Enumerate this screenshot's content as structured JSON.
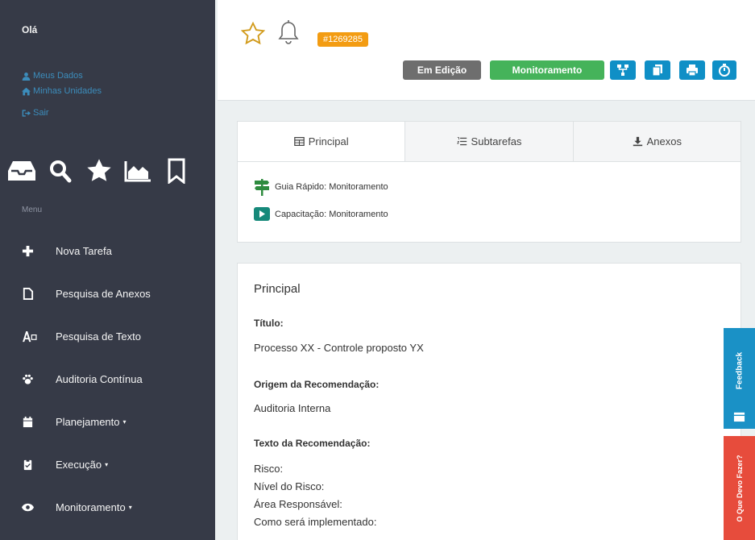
{
  "user": {
    "greeting": "Olá",
    "links": [
      {
        "label": "Meus Dados",
        "icon": "user-icon"
      },
      {
        "label": "Minhas Unidades",
        "icon": "home-icon"
      },
      {
        "label": "Sair",
        "icon": "sign-out-icon"
      }
    ]
  },
  "quick_icons": [
    "inbox-icon",
    "search-icon",
    "star-icon",
    "chart-area-icon",
    "bookmark-icon"
  ],
  "menu": {
    "label": "Menu",
    "items": [
      {
        "label": "Nova Tarefa",
        "icon": "plus-icon"
      },
      {
        "label": "Pesquisa de Anexos",
        "icon": "file-icon"
      },
      {
        "label": "Pesquisa de Texto",
        "icon": "text-search-icon"
      },
      {
        "label": "Auditoria Contínua",
        "icon": "paw-icon"
      },
      {
        "label": "Planejamento",
        "icon": "calendar-icon"
      },
      {
        "label": "Execução",
        "icon": "clipboard-icon"
      },
      {
        "label": "Monitoramento",
        "icon": "eye-icon"
      }
    ]
  },
  "header": {
    "task_id": "#1269285",
    "status_edit": "Em Edição",
    "status_monitor": "Monitoramento"
  },
  "tabs": [
    {
      "label": "Principal",
      "icon": "table-icon"
    },
    {
      "label": "Subtarefas",
      "icon": "list-ol-icon"
    },
    {
      "label": "Anexos",
      "icon": "download-icon"
    }
  ],
  "guides": {
    "quick_guide": "Guia Rápido: Monitoramento",
    "training": "Capacitação: Monitoramento"
  },
  "principal": {
    "title": "Principal",
    "titulo_label": "Título:",
    "titulo_value": "Processo XX - Controle proposto YX",
    "origem_label": "Origem da Recomendação:",
    "origem_value": "Auditoria Interna",
    "texto_label": "Texto da Recomendação:",
    "risco": "Risco:",
    "nivel": "Nível do Risco:",
    "area": "Área Responsável:",
    "como": "Como será implementado:"
  },
  "side_tabs": {
    "feedback": "Feedback",
    "help": "O Que Devo Fazer?"
  }
}
